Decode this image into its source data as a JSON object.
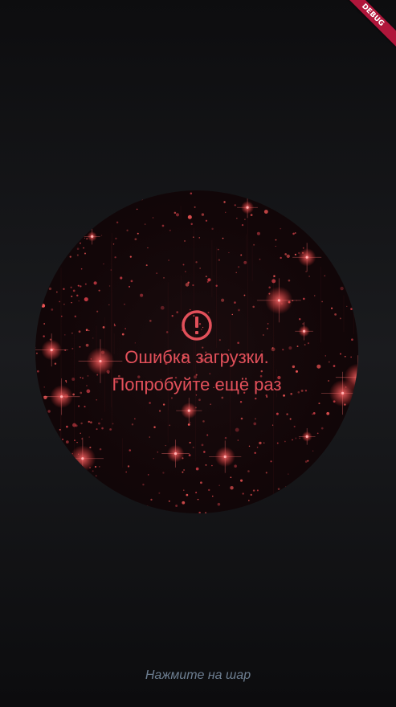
{
  "debug_banner": {
    "label": "DEBUG"
  },
  "ball": {
    "error_icon": "error-exclamation-icon",
    "error_line1": "Ошибка загрузки.",
    "error_line2": "Попробуйте ещё раз"
  },
  "hint": {
    "text": "Нажмите на шар"
  },
  "colors": {
    "accent": "#e2505a",
    "hint": "#6d7e91",
    "debug_ribbon": "#b0163b",
    "background": "#151618"
  }
}
